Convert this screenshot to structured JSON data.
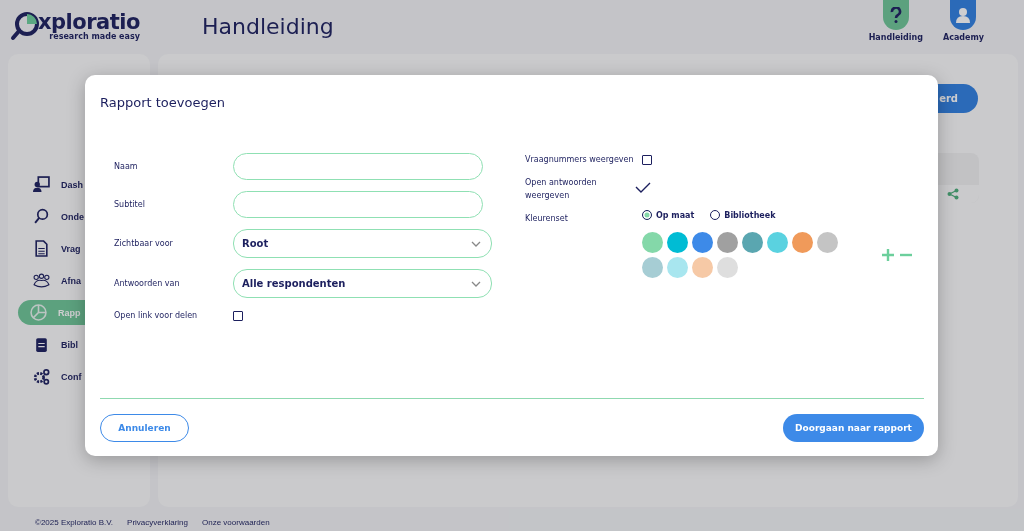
{
  "header": {
    "logo": {
      "name": "xploratio",
      "tagline": "research made easy"
    },
    "page_title": "Handleiding",
    "buttons": [
      {
        "label": "Handleiding",
        "kind": "help"
      },
      {
        "label": "Academy",
        "kind": "user"
      }
    ]
  },
  "sidebar": {
    "items": [
      {
        "label": "Dash",
        "selected": false
      },
      {
        "label": "Onde",
        "selected": false
      },
      {
        "label": "Vrag",
        "selected": false
      },
      {
        "label": "Afna",
        "selected": false
      },
      {
        "label": "Rapp",
        "selected": true
      },
      {
        "label": "Bibl",
        "selected": false
      },
      {
        "label": "Conf",
        "selected": false
      }
    ]
  },
  "background_button": {
    "label": "erd"
  },
  "dialog": {
    "title": "Rapport toevoegen",
    "left_fields": [
      {
        "label": "Naam",
        "kind": "text"
      },
      {
        "label": "Subtitel",
        "kind": "text"
      },
      {
        "label": "Zichtbaar voor",
        "kind": "select",
        "value": "Root"
      },
      {
        "label": "Antwoorden van",
        "kind": "select",
        "value": "Alle respondenten"
      },
      {
        "label": "Open link voor delen",
        "kind": "checkbox",
        "checked": false
      }
    ],
    "right_fields": [
      {
        "label": "Vraagnummers weergeven",
        "kind": "checkbox",
        "checked": false
      },
      {
        "label": "Open antwoorden weergeven",
        "kind": "tick",
        "checked": true
      },
      {
        "label": "Kleurenset",
        "kind": "colors",
        "options": [
          {
            "label": "Op maat",
            "selected": true
          },
          {
            "label": "Bibliotheek",
            "selected": false
          }
        ],
        "colors": [
          {
            "color": "#84d8a9"
          },
          {
            "color": "#00bcd4"
          },
          {
            "color": "#3d8ae8"
          },
          {
            "color": "#a0a0a0"
          },
          {
            "color": "#5aa6b0"
          },
          {
            "color": "#5ad2e0"
          },
          {
            "color": "#f09a5a"
          },
          {
            "color": "#c4c4c4"
          },
          {
            "color": "#a6cdd4"
          },
          {
            "color": "#a8e6ef"
          },
          {
            "color": "#f6c9a6"
          },
          {
            "color": "#dedede"
          }
        ]
      }
    ],
    "cancel": "Annuleren",
    "confirm": "Doorgaan naar rapport"
  },
  "footer": [
    "©2025 Exploratio B.V.",
    "Privacyverklaring",
    "Onze voorwaarden"
  ]
}
